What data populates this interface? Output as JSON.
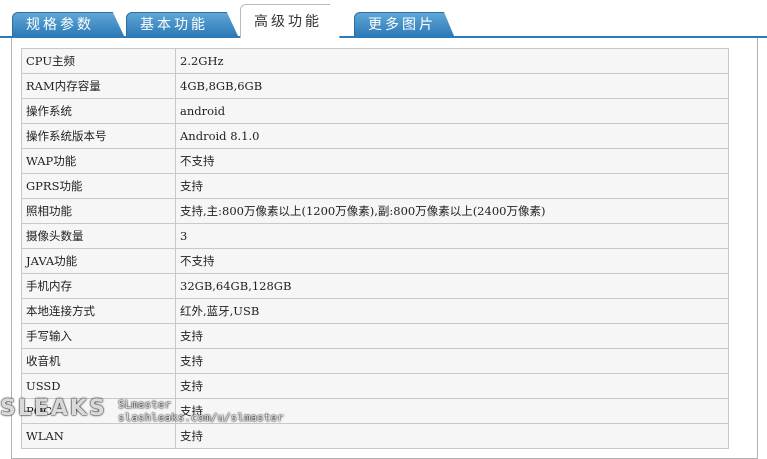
{
  "tabs": [
    {
      "label": "规格参数"
    },
    {
      "label": "基本功能"
    },
    {
      "label": "高级功能"
    },
    {
      "label": "更多图片"
    }
  ],
  "active_tab": "高级功能",
  "specs": [
    {
      "key": "CPU主频",
      "value": "2.2GHz"
    },
    {
      "key": "RAM内存容量",
      "value": "4GB,8GB,6GB"
    },
    {
      "key": "操作系统",
      "value": "android"
    },
    {
      "key": "操作系统版本号",
      "value": "Android 8.1.0"
    },
    {
      "key": "WAP功能",
      "value": "不支持"
    },
    {
      "key": "GPRS功能",
      "value": "支持"
    },
    {
      "key": "照相功能",
      "value": "支持,主:800万像素以上(1200万像素),副:800万像素以上(2400万像素)"
    },
    {
      "key": "摄像头数量",
      "value": "3"
    },
    {
      "key": "JAVA功能",
      "value": "不支持"
    },
    {
      "key": "手机内存",
      "value": "32GB,64GB,128GB"
    },
    {
      "key": "本地连接方式",
      "value": "红外,蓝牙,USB"
    },
    {
      "key": "手写输入",
      "value": "支持"
    },
    {
      "key": "收音机",
      "value": "支持"
    },
    {
      "key": "USSD",
      "value": "支持"
    },
    {
      "key": "POC",
      "value": "支持"
    },
    {
      "key": "WLAN",
      "value": "支持"
    }
  ],
  "watermark": {
    "logo": "SLEAKS",
    "user": "SLmaster",
    "url": "slashleaks.com/u/slmaster"
  }
}
